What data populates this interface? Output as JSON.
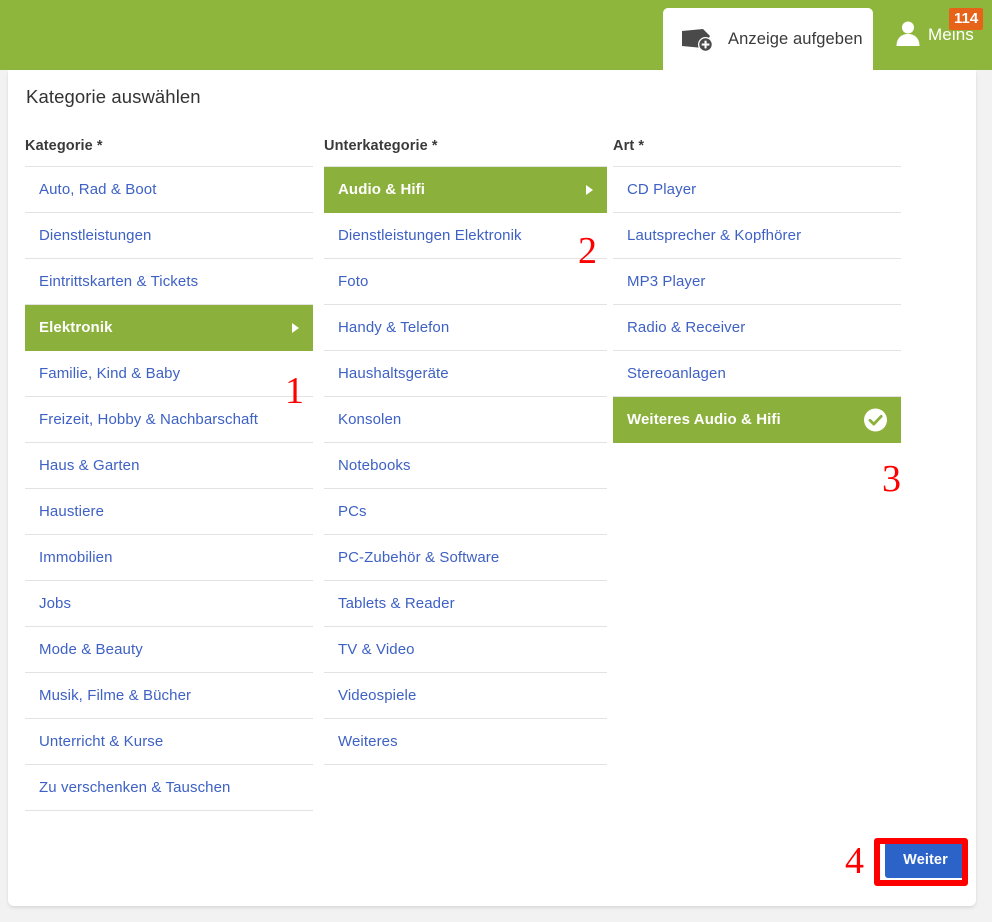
{
  "header": {
    "post_ad_tab_label": "Anzeige aufgeben",
    "post_ad_icon": "tag-plus-icon",
    "mine_label": "Meins",
    "mine_icon": "user-icon",
    "mine_badge_count": "114",
    "bar_color": "#8FB63C",
    "badge_color": "#E8631A"
  },
  "page": {
    "title": "Kategorie auswählen",
    "selected_color": "#8CB03C",
    "link_color": "#3E61C4"
  },
  "columns": [
    {
      "header": "Kategorie *",
      "items": [
        {
          "label": "Auto, Rad & Boot",
          "selected": false,
          "indicator": "none"
        },
        {
          "label": "Dienstleistungen",
          "selected": false,
          "indicator": "none"
        },
        {
          "label": "Eintrittskarten & Tickets",
          "selected": false,
          "indicator": "none"
        },
        {
          "label": "Elektronik",
          "selected": true,
          "indicator": "arrow"
        },
        {
          "label": "Familie, Kind & Baby",
          "selected": false,
          "indicator": "none"
        },
        {
          "label": "Freizeit, Hobby & Nachbarschaft",
          "selected": false,
          "indicator": "none"
        },
        {
          "label": "Haus & Garten",
          "selected": false,
          "indicator": "none"
        },
        {
          "label": "Haustiere",
          "selected": false,
          "indicator": "none"
        },
        {
          "label": "Immobilien",
          "selected": false,
          "indicator": "none"
        },
        {
          "label": "Jobs",
          "selected": false,
          "indicator": "none"
        },
        {
          "label": "Mode & Beauty",
          "selected": false,
          "indicator": "none"
        },
        {
          "label": "Musik, Filme & Bücher",
          "selected": false,
          "indicator": "none"
        },
        {
          "label": "Unterricht & Kurse",
          "selected": false,
          "indicator": "none"
        },
        {
          "label": "Zu verschenken & Tauschen",
          "selected": false,
          "indicator": "none"
        }
      ]
    },
    {
      "header": "Unterkategorie *",
      "items": [
        {
          "label": "Audio & Hifi",
          "selected": true,
          "indicator": "arrow"
        },
        {
          "label": "Dienstleistungen Elektronik",
          "selected": false,
          "indicator": "none"
        },
        {
          "label": "Foto",
          "selected": false,
          "indicator": "none"
        },
        {
          "label": "Handy & Telefon",
          "selected": false,
          "indicator": "none"
        },
        {
          "label": "Haushaltsgeräte",
          "selected": false,
          "indicator": "none"
        },
        {
          "label": "Konsolen",
          "selected": false,
          "indicator": "none"
        },
        {
          "label": "Notebooks",
          "selected": false,
          "indicator": "none"
        },
        {
          "label": "PCs",
          "selected": false,
          "indicator": "none"
        },
        {
          "label": "PC-Zubehör & Software",
          "selected": false,
          "indicator": "none"
        },
        {
          "label": "Tablets & Reader",
          "selected": false,
          "indicator": "none"
        },
        {
          "label": "TV & Video",
          "selected": false,
          "indicator": "none"
        },
        {
          "label": "Videospiele",
          "selected": false,
          "indicator": "none"
        },
        {
          "label": "Weiteres",
          "selected": false,
          "indicator": "none"
        }
      ]
    },
    {
      "header": "Art *",
      "items": [
        {
          "label": "CD Player",
          "selected": false,
          "indicator": "none"
        },
        {
          "label": "Lautsprecher & Kopfhörer",
          "selected": false,
          "indicator": "none"
        },
        {
          "label": "MP3 Player",
          "selected": false,
          "indicator": "none"
        },
        {
          "label": "Radio & Receiver",
          "selected": false,
          "indicator": "none"
        },
        {
          "label": "Stereoanlagen",
          "selected": false,
          "indicator": "none"
        },
        {
          "label": "Weiteres Audio & Hifi",
          "selected": true,
          "indicator": "check"
        }
      ]
    }
  ],
  "footer": {
    "next_label": "Weiter",
    "next_color": "#2C63C8"
  },
  "annotations": {
    "color": "#FF0000",
    "step_1": "1",
    "step_2": "2",
    "step_3": "3",
    "step_4": "4"
  }
}
